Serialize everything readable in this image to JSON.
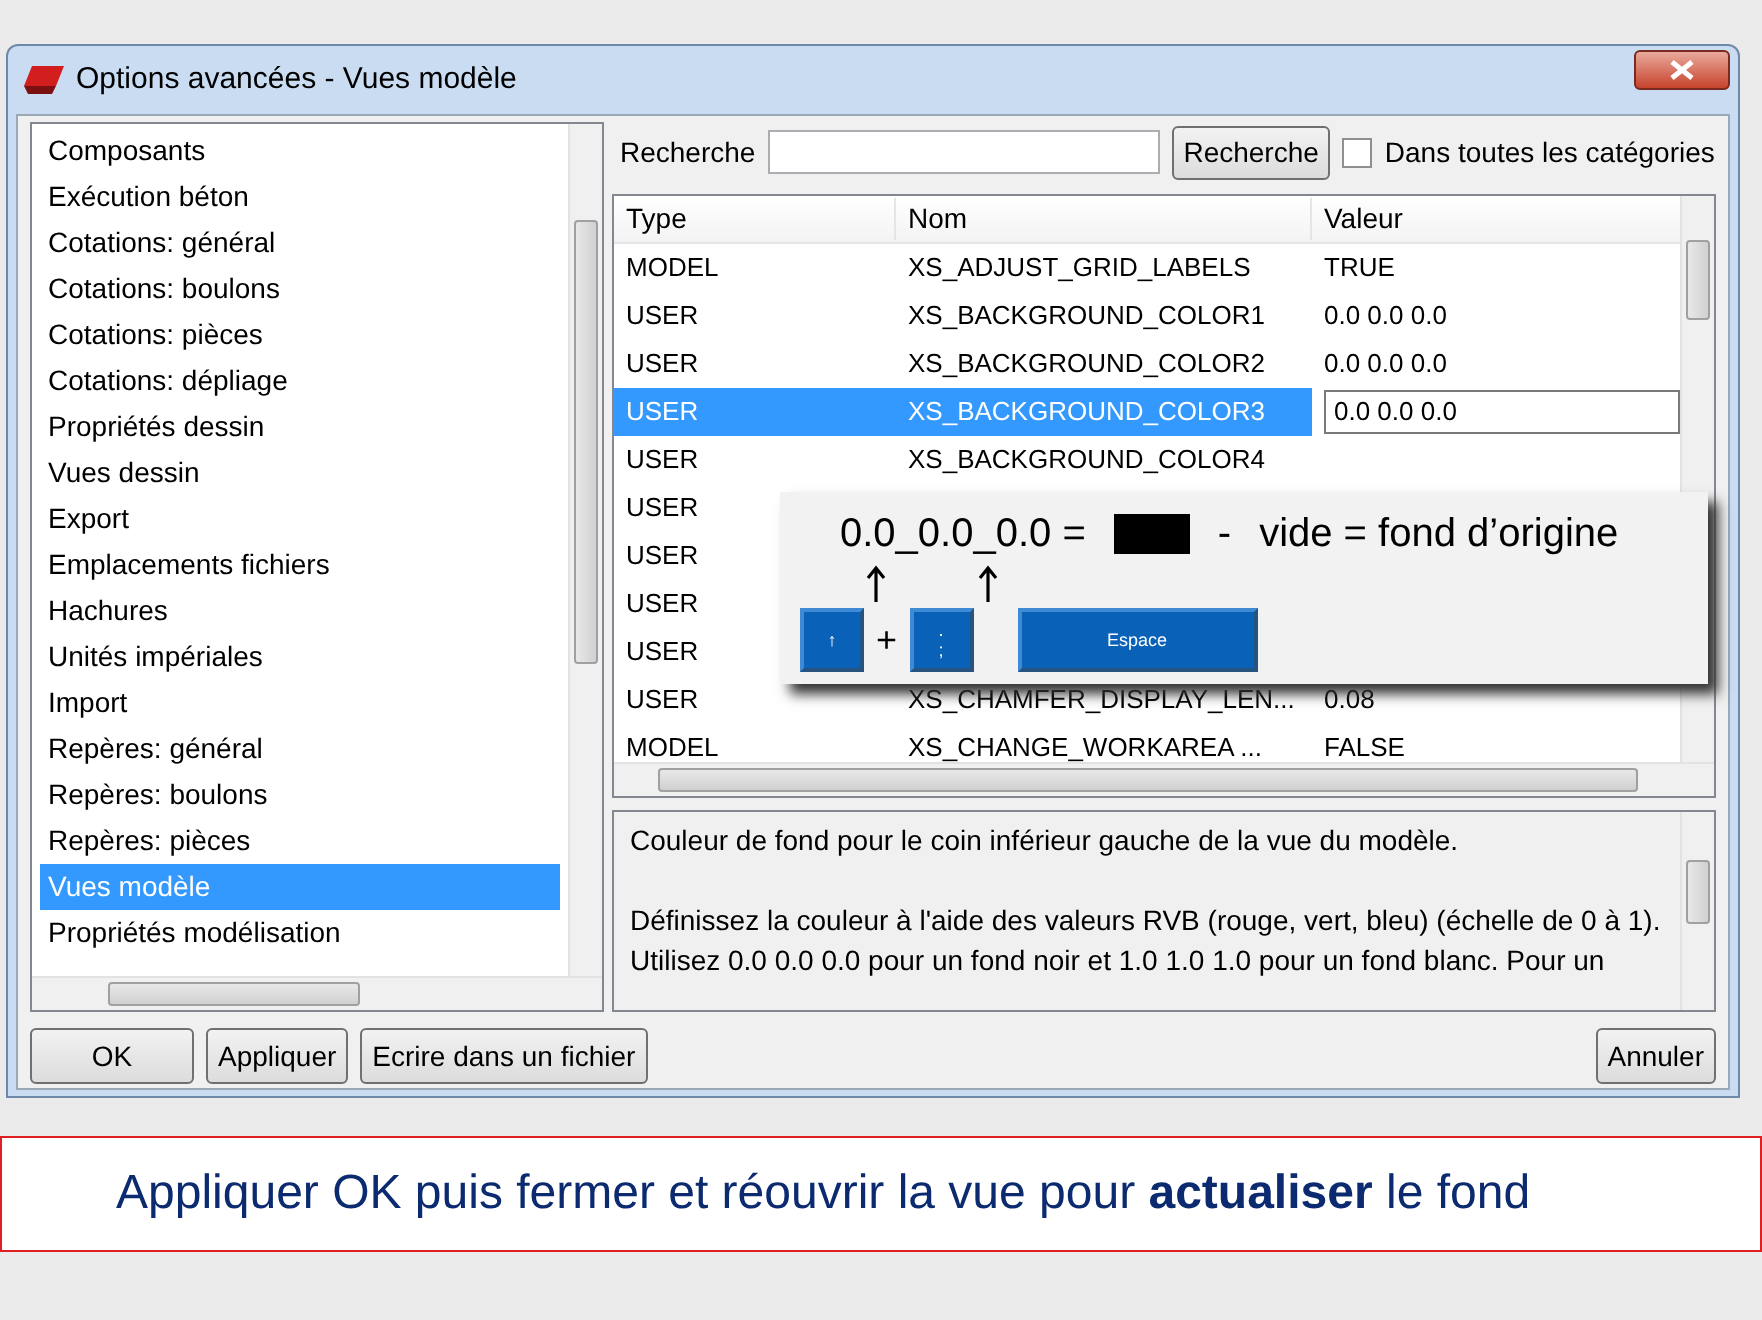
{
  "window": {
    "title": "Options avancées - Vues modèle"
  },
  "sidebar": {
    "items": [
      {
        "label": "Composants",
        "selected": false
      },
      {
        "label": "Exécution béton",
        "selected": false
      },
      {
        "label": "Cotations: général",
        "selected": false
      },
      {
        "label": "Cotations: boulons",
        "selected": false
      },
      {
        "label": "Cotations: pièces",
        "selected": false
      },
      {
        "label": "Cotations: dépliage",
        "selected": false
      },
      {
        "label": "Propriétés dessin",
        "selected": false
      },
      {
        "label": "Vues dessin",
        "selected": false
      },
      {
        "label": "Export",
        "selected": false
      },
      {
        "label": "Emplacements fichiers",
        "selected": false
      },
      {
        "label": "Hachures",
        "selected": false
      },
      {
        "label": "Unités impériales",
        "selected": false
      },
      {
        "label": "Import",
        "selected": false
      },
      {
        "label": "Repères: général",
        "selected": false
      },
      {
        "label": "Repères: boulons",
        "selected": false
      },
      {
        "label": "Repères: pièces",
        "selected": false
      },
      {
        "label": "Vues modèle",
        "selected": true
      },
      {
        "label": "Propriétés modélisation",
        "selected": false
      }
    ]
  },
  "search": {
    "label": "Recherche",
    "button": "Recherche",
    "all_categories": {
      "label": "Dans toutes les catégories",
      "checked": false
    }
  },
  "table": {
    "columns": [
      "Type",
      "Nom",
      "Valeur"
    ],
    "rows": [
      {
        "type": "MODEL",
        "name": "XS_ADJUST_GRID_LABELS",
        "value": "TRUE",
        "selected": false
      },
      {
        "type": "USER",
        "name": "XS_BACKGROUND_COLOR1",
        "value": "0.0 0.0 0.0",
        "selected": false
      },
      {
        "type": "USER",
        "name": "XS_BACKGROUND_COLOR2",
        "value": "0.0 0.0 0.0",
        "selected": false
      },
      {
        "type": "USER",
        "name": "XS_BACKGROUND_COLOR3",
        "value": "0.0 0.0 0.0",
        "selected": true
      },
      {
        "type": "USER",
        "name": "XS_BACKGROUND_COLOR4",
        "selected": false
      },
      {
        "type": "USER",
        "selected": false
      },
      {
        "type": "USER",
        "selected": false
      },
      {
        "type": "USER",
        "selected": false
      },
      {
        "type": "USER",
        "selected": false
      },
      {
        "type": "USER",
        "name": "XS_CHAMFER_DISPLAY_LEN...",
        "value": "0.08",
        "selected": false
      },
      {
        "type": "MODEL",
        "name": "XS_CHANGE_WORKAREA ...",
        "value": "FALSE",
        "selected": false
      }
    ]
  },
  "hint": {
    "formula": "0.0_0.0_0.0 =",
    "dash": "-",
    "note": "vide = fond d’origine",
    "plus": "+",
    "keys": [
      {
        "kind": "small",
        "labels": [
          "↑"
        ]
      },
      {
        "kind": "small",
        "labels": [
          ".",
          ";"
        ]
      },
      {
        "kind": "wide",
        "labels": [
          "Espace"
        ]
      }
    ]
  },
  "description": [
    "Couleur de fond pour le coin inférieur gauche de la vue du modèle.",
    "Définissez la couleur à l'aide des valeurs RVB (rouge, vert, bleu) (échelle de 0 à 1). Utilisez 0.0 0.0 0.0 pour un fond noir et 1.0 1.0 1.0 pour un fond blanc. Pour un"
  ],
  "buttons": [
    "OK",
    "Appliquer",
    "Ecrire dans un fichier",
    "Annuler"
  ],
  "banner": "Appliquer OK puis fermer et réouvrir la vue pour **actualiser** le fond"
}
